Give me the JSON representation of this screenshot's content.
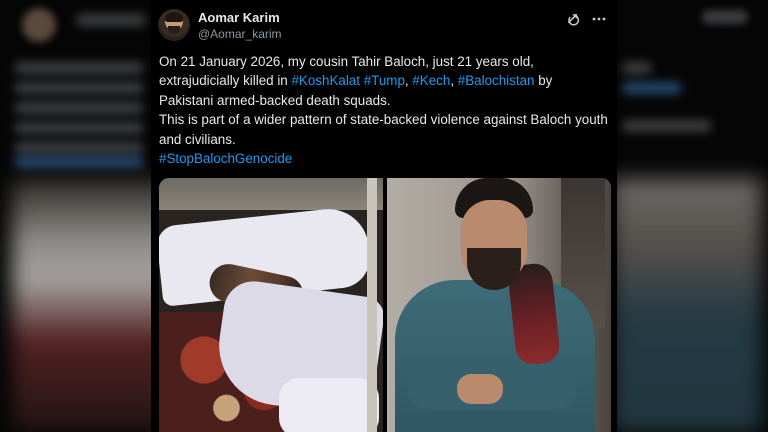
{
  "tweet": {
    "author": {
      "display_name": "Aomar Karim",
      "handle": "@Aomar_karim"
    },
    "header_icons": [
      "grok-icon",
      "more-options-icon"
    ],
    "paragraphs": [
      {
        "segments": [
          {
            "text": "On 21 January 2026, my cousin Tahir Baloch, just 21 years old, extrajudicially killed in ",
            "tag": false
          },
          {
            "text": "#KoshKalat",
            "tag": true
          },
          {
            "text": " ",
            "tag": false
          },
          {
            "text": "#Tump",
            "tag": true
          },
          {
            "text": ", ",
            "tag": false
          },
          {
            "text": "#Kech",
            "tag": true
          },
          {
            "text": ", ",
            "tag": false
          },
          {
            "text": "#Balochistan",
            "tag": true
          },
          {
            "text": " by Pakistani armed-backed death squads.",
            "tag": false
          }
        ]
      },
      {
        "segments": [
          {
            "text": "This is part of a wider pattern of state-backed violence against Baloch youth and civilians.",
            "tag": false
          }
        ]
      },
      {
        "segments": [
          {
            "text": "#StopBalochGenocide",
            "tag": true
          }
        ]
      }
    ],
    "media": [
      {
        "name": "photo-shrouded-body"
      },
      {
        "name": "photo-portrait"
      }
    ]
  },
  "colors": {
    "background": "#000000",
    "text": "#e7e9ea",
    "secondary_text": "#8b98a5",
    "hashtag": "#1d9bf0"
  }
}
